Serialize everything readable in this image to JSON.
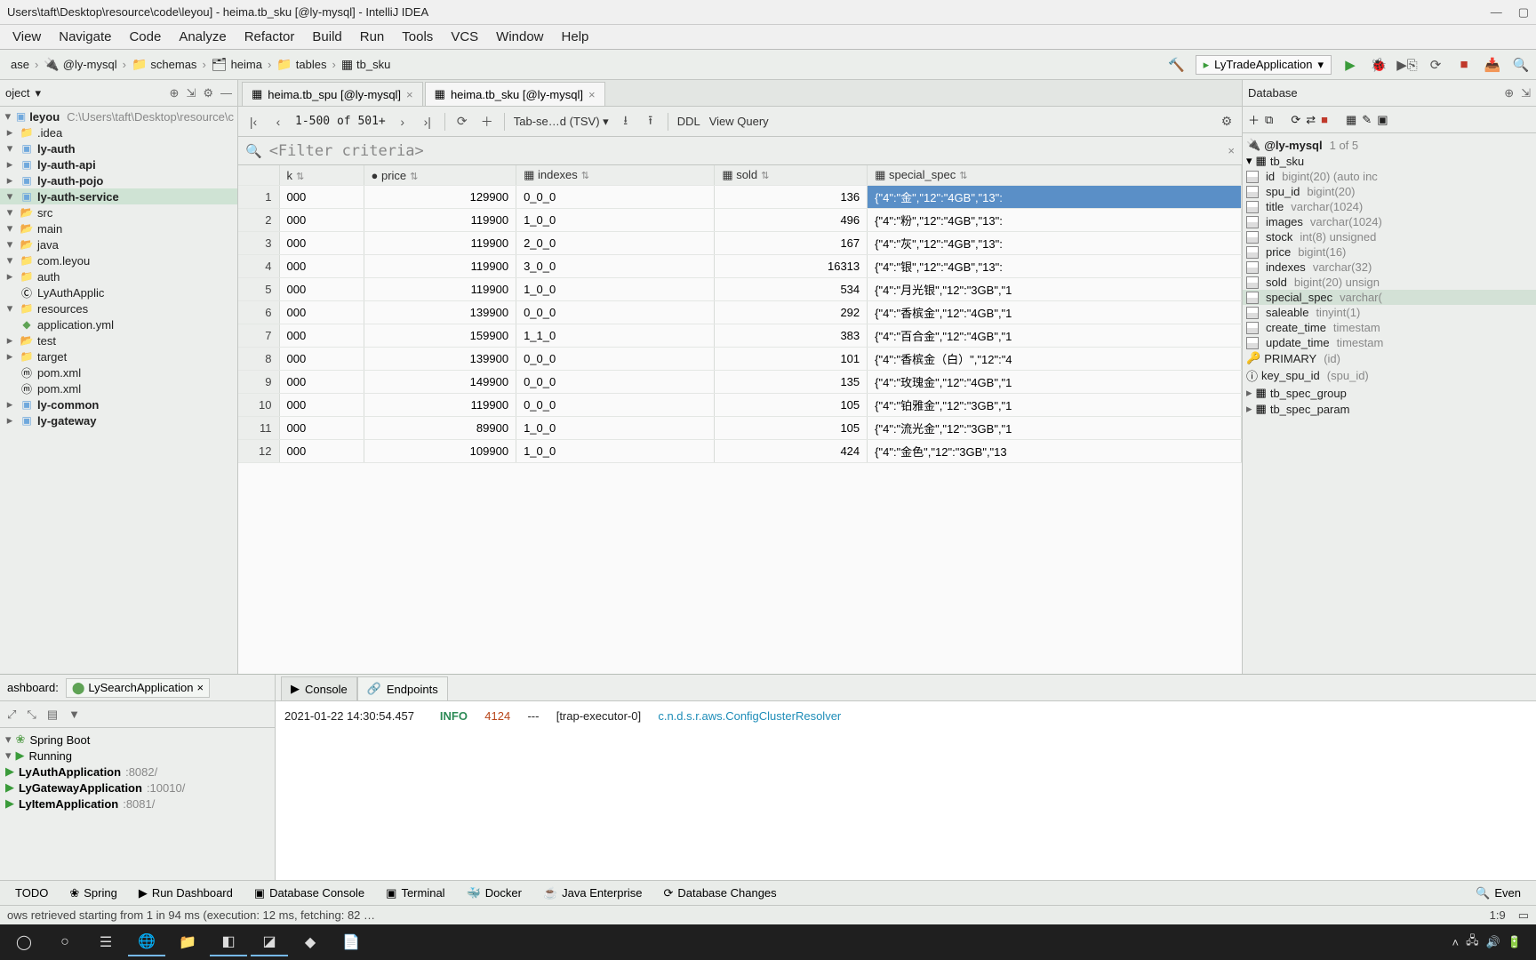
{
  "window": {
    "title": "Users\\taft\\Desktop\\resource\\code\\leyou] - heima.tb_sku [@ly-mysql] - IntelliJ IDEA"
  },
  "menu": [
    "View",
    "Navigate",
    "Code",
    "Analyze",
    "Refactor",
    "Build",
    "Run",
    "Tools",
    "VCS",
    "Window",
    "Help"
  ],
  "breadcrumbs": [
    {
      "icon": "db",
      "label": "ase"
    },
    {
      "icon": "ds",
      "label": "@ly-mysql"
    },
    {
      "icon": "folder",
      "label": "schemas"
    },
    {
      "icon": "schema",
      "label": "heima"
    },
    {
      "icon": "folder",
      "label": "tables"
    },
    {
      "icon": "table",
      "label": "tb_sku"
    }
  ],
  "run_config": "LyTradeApplication",
  "project": {
    "title": "oject",
    "root": "leyou",
    "root_path": "C:\\Users\\taft\\Desktop\\resource\\c",
    "nodes": [
      {
        "d": 2,
        "arr": ">",
        "icn": "folder",
        "label": ".idea"
      },
      {
        "d": 2,
        "arr": "v",
        "icn": "mod",
        "label": "ly-auth"
      },
      {
        "d": 3,
        "arr": ">",
        "icn": "mod",
        "label": "ly-auth-api"
      },
      {
        "d": 3,
        "arr": ">",
        "icn": "mod",
        "label": "ly-auth-pojo"
      },
      {
        "d": 3,
        "arr": "v",
        "icn": "mod",
        "label": "ly-auth-service",
        "sel": true
      },
      {
        "d": 4,
        "arr": "v",
        "icn": "bluefold",
        "label": "src"
      },
      {
        "d": 5,
        "arr": "v",
        "icn": "bluefold",
        "label": "main"
      },
      {
        "d": 6,
        "arr": "v",
        "icn": "bluefold",
        "label": "java"
      },
      {
        "d": 7,
        "arr": "v",
        "icn": "folder",
        "label": "com.leyou"
      },
      {
        "d": 8,
        "arr": ">",
        "icn": "folder",
        "label": "auth"
      },
      {
        "d": 8,
        "arr": "",
        "icn": "class",
        "label": "LyAuthApplic"
      },
      {
        "d": 6,
        "arr": "v",
        "icn": "folder",
        "label": "resources"
      },
      {
        "d": 7,
        "arr": "",
        "icn": "yfile",
        "label": "application.yml"
      },
      {
        "d": 4,
        "arr": ">",
        "icn": "bluefold",
        "label": "test"
      },
      {
        "d": 3,
        "arr": ">",
        "icn": "folder",
        "label": "target"
      },
      {
        "d": 3,
        "arr": "",
        "icn": "mfile",
        "label": "pom.xml"
      },
      {
        "d": 2,
        "arr": "",
        "icn": "mfile",
        "label": "pom.xml"
      },
      {
        "d": 2,
        "arr": ">",
        "icn": "mod",
        "label": "ly-common"
      },
      {
        "d": 2,
        "arr": ">",
        "icn": "mod",
        "label": "ly-gateway"
      }
    ]
  },
  "editor_tabs": [
    {
      "label": "heima.tb_spu [@ly-mysql]",
      "active": false
    },
    {
      "label": "heima.tb_sku [@ly-mysql]",
      "active": true
    }
  ],
  "db_toolbar": {
    "rowrange": "1-500 of 501+",
    "export_fmt": "Tab-se…d (TSV)",
    "ddl": "DDL",
    "viewquery": "View Query"
  },
  "filter_placeholder": "<Filter criteria>",
  "columns": [
    "k",
    "price",
    "indexes",
    "sold",
    "special_spec"
  ],
  "rows": [
    {
      "n": 1,
      "k": "000",
      "price": "129900",
      "indexes": "0_0_0",
      "sold": "136",
      "spec": "{\"4\":\"金\",\"12\":\"4GB\",\"13\":",
      "sel": true
    },
    {
      "n": 2,
      "k": "000",
      "price": "119900",
      "indexes": "1_0_0",
      "sold": "496",
      "spec": "{\"4\":\"粉\",\"12\":\"4GB\",\"13\":"
    },
    {
      "n": 3,
      "k": "000",
      "price": "119900",
      "indexes": "2_0_0",
      "sold": "167",
      "spec": "{\"4\":\"灰\",\"12\":\"4GB\",\"13\":"
    },
    {
      "n": 4,
      "k": "000",
      "price": "119900",
      "indexes": "3_0_0",
      "sold": "16313",
      "spec": "{\"4\":\"银\",\"12\":\"4GB\",\"13\":"
    },
    {
      "n": 5,
      "k": "000",
      "price": "119900",
      "indexes": "1_0_0",
      "sold": "534",
      "spec": "{\"4\":\"月光银\",\"12\":\"3GB\",\"1"
    },
    {
      "n": 6,
      "k": "000",
      "price": "139900",
      "indexes": "0_0_0",
      "sold": "292",
      "spec": "{\"4\":\"香槟金\",\"12\":\"4GB\",\"1"
    },
    {
      "n": 7,
      "k": "000",
      "price": "159900",
      "indexes": "1_1_0",
      "sold": "383",
      "spec": "{\"4\":\"百合金\",\"12\":\"4GB\",\"1"
    },
    {
      "n": 8,
      "k": "000",
      "price": "139900",
      "indexes": "0_0_0",
      "sold": "101",
      "spec": "{\"4\":\"香槟金（白）\",\"12\":\"4"
    },
    {
      "n": 9,
      "k": "000",
      "price": "149900",
      "indexes": "0_0_0",
      "sold": "135",
      "spec": "{\"4\":\"玫瑰金\",\"12\":\"4GB\",\"1"
    },
    {
      "n": 10,
      "k": "000",
      "price": "119900",
      "indexes": "0_0_0",
      "sold": "105",
      "spec": "{\"4\":\"铂雅金\",\"12\":\"3GB\",\"1"
    },
    {
      "n": 11,
      "k": "000",
      "price": "89900",
      "indexes": "1_0_0",
      "sold": "105",
      "spec": "{\"4\":\"流光金\",\"12\":\"3GB\",\"1"
    },
    {
      "n": 12,
      "k": "000",
      "price": "109900",
      "indexes": "1_0_0",
      "sold": "424",
      "spec": "{\"4\":\"金色\",\"12\":\"3GB\",\"13"
    }
  ],
  "database_panel": {
    "title": "Database",
    "datasource": "@ly-mysql",
    "ds_suffix": "1 of 5",
    "table": "tb_sku",
    "columns": [
      {
        "name": "id",
        "type": "bigint(20) (auto inc"
      },
      {
        "name": "spu_id",
        "type": "bigint(20)"
      },
      {
        "name": "title",
        "type": "varchar(1024)"
      },
      {
        "name": "images",
        "type": "varchar(1024)"
      },
      {
        "name": "stock",
        "type": "int(8) unsigned"
      },
      {
        "name": "price",
        "type": "bigint(16)"
      },
      {
        "name": "indexes",
        "type": "varchar(32)"
      },
      {
        "name": "sold",
        "type": "bigint(20) unsign"
      },
      {
        "name": "special_spec",
        "type": "varchar(",
        "sel": true
      },
      {
        "name": "saleable",
        "type": "tinyint(1)"
      },
      {
        "name": "create_time",
        "type": "timestam"
      },
      {
        "name": "update_time",
        "type": "timestam"
      }
    ],
    "keys": [
      {
        "icon": "key",
        "name": "PRIMARY",
        "suffix": "(id)"
      },
      {
        "icon": "idx",
        "name": "key_spu_id",
        "suffix": "(spu_id)"
      }
    ],
    "siblings": [
      "tb_spec_group",
      "tb_spec_param"
    ]
  },
  "dashboard": {
    "header": "ashboard:",
    "tab": "LySearchApplication",
    "springboot": "Spring Boot",
    "running": "Running",
    "apps": [
      {
        "name": "LyAuthApplication",
        "port": ":8082/"
      },
      {
        "name": "LyGatewayApplication",
        "port": ":10010/"
      },
      {
        "name": "LyItemApplication",
        "port": ":8081/"
      }
    ],
    "console_tabs": [
      "Console",
      "Endpoints"
    ],
    "log": {
      "ts": "2021-01-22 14:30:54.457",
      "level": "INFO",
      "pid": "4124",
      "sep": "---",
      "thread": "[trap-executor-0]",
      "class": "c.n.d.s.r.aws.ConfigClusterResolver"
    }
  },
  "bottom_tools": [
    "TODO",
    "Spring",
    "Run Dashboard",
    "Database Console",
    "Terminal",
    "Docker",
    "Java Enterprise",
    "Database Changes"
  ],
  "bottom_tools_right": "Even",
  "status": {
    "msg": "ows retrieved starting from 1 in 94 ms (execution: 12 ms, fetching: 82 …",
    "pos": "1:9"
  }
}
